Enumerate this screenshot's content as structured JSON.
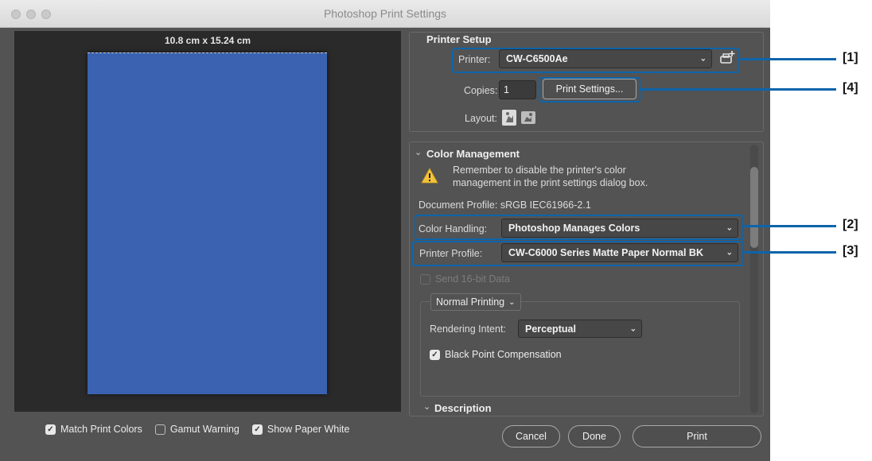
{
  "window": {
    "title": "Photoshop Print Settings"
  },
  "preview": {
    "dimensions": "10.8 cm x 15.24 cm",
    "paper_color": "#3a62b0"
  },
  "bottom_options": [
    {
      "label": "Match Print Colors",
      "checked": true
    },
    {
      "label": "Gamut Warning",
      "checked": false
    },
    {
      "label": "Show Paper White",
      "checked": true
    }
  ],
  "printer_setup": {
    "title": "Printer Setup",
    "printer_label": "Printer:",
    "printer_value": "CW-C6500Ae",
    "copies_label": "Copies:",
    "copies_value": "1",
    "print_settings_button": "Print Settings...",
    "layout_label": "Layout:"
  },
  "color_management": {
    "title": "Color Management",
    "warning_text": "Remember to disable the printer's color management in the print settings dialog box.",
    "document_profile": "Document Profile: sRGB IEC61966-2.1",
    "color_handling_label": "Color Handling:",
    "color_handling_value": "Photoshop Manages Colors",
    "printer_profile_label": "Printer Profile:",
    "printer_profile_value": "CW-C6000 Series Matte Paper Normal BK",
    "send_16bit_label": "Send 16-bit Data",
    "normal_printing": "Normal Printing",
    "rendering_intent_label": "Rendering Intent:",
    "rendering_intent_value": "Perceptual",
    "black_point_label": "Black Point Compensation"
  },
  "description": {
    "title": "Description"
  },
  "buttons": {
    "cancel": "Cancel",
    "done": "Done",
    "print": "Print"
  },
  "callouts": [
    "[1]",
    "[2]",
    "[3]",
    "[4]"
  ],
  "colors": {
    "callout": "#0d64aa"
  }
}
